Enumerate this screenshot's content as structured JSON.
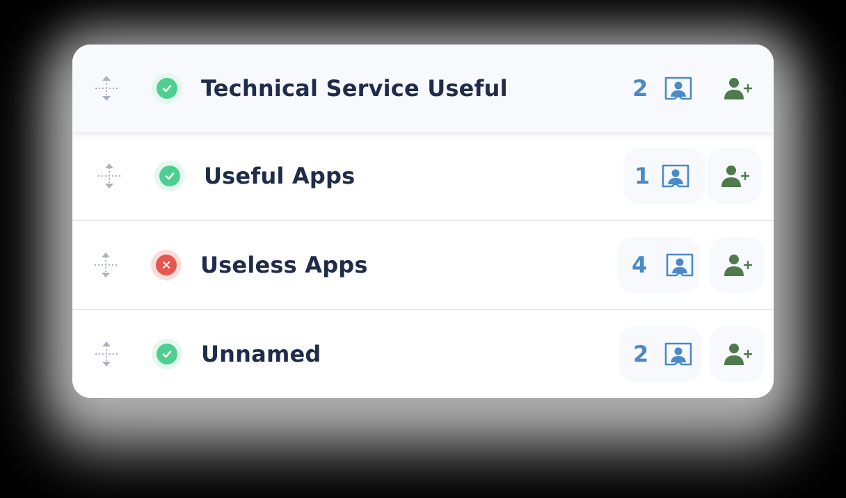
{
  "icons": {
    "drag": "drag-handle-icon",
    "status_ok": "check-circle-icon",
    "status_error": "x-circle-icon",
    "folder": "profile-folder-icon",
    "add_user": "add-user-icon"
  },
  "colors": {
    "title": "#1f2c4a",
    "count": "#4a8ac7",
    "ok": "#4fcf8f",
    "error": "#e5574f",
    "add_user": "#4f7a4c"
  },
  "rows": [
    {
      "title": "Technical Service Useful",
      "status": "ok",
      "count": "2"
    },
    {
      "title": "Useful Apps",
      "status": "ok",
      "count": "1"
    },
    {
      "title": "Useless Apps",
      "status": "error",
      "count": "4"
    },
    {
      "title": "Unnamed",
      "status": "ok",
      "count": "2"
    }
  ]
}
